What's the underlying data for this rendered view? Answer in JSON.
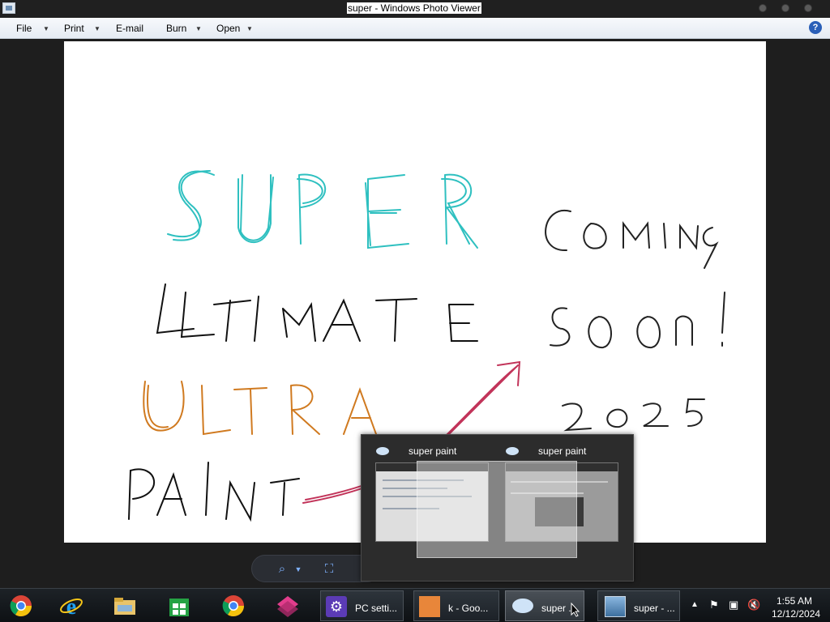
{
  "window": {
    "title": "super - Windows Photo Viewer"
  },
  "menu": {
    "items": [
      "File",
      "Print",
      "E-mail",
      "Burn",
      "Open"
    ],
    "help": "?"
  },
  "photo": {
    "words": [
      "SUPER",
      "ULTIMATE",
      "ULTRA",
      "PAINT",
      "Coming",
      "soon!",
      "2025"
    ],
    "colors": {
      "super": "#2fc0c0",
      "ultimate": "#111111",
      "ultra": "#d07a20",
      "paint": "#111111",
      "arrow": "#c2345a",
      "coming": "#222222"
    }
  },
  "preview": {
    "items": [
      {
        "title": "super paint"
      },
      {
        "title": "super paint"
      }
    ]
  },
  "taskbar": {
    "pinned": [
      "chrome-icon",
      "internet-explorer-icon",
      "file-explorer-icon",
      "store-icon",
      "google-chrome-icon",
      "super-paint-icon"
    ],
    "buttons": [
      {
        "label": "PC setti..."
      },
      {
        "label": "k - Goo..."
      },
      {
        "label": "super ..."
      },
      {
        "label": "super - ..."
      }
    ],
    "tray": {
      "time": "1:55 AM",
      "date": "12/12/2024"
    }
  }
}
